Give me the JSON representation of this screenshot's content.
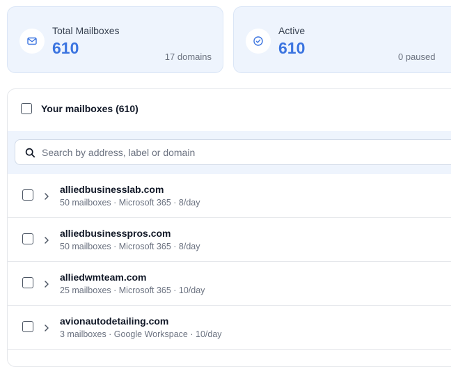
{
  "stats": [
    {
      "label": "Total Mailboxes",
      "value": "610",
      "sub": "17 domains",
      "icon": "mail-icon"
    },
    {
      "label": "Active",
      "value": "610",
      "sub": "0 paused",
      "icon": "check-circle-icon"
    }
  ],
  "mailboxes": {
    "title": "Your mailboxes (610)",
    "search_placeholder": "Search by address, label or domain",
    "search_value": "",
    "rows": [
      {
        "domain": "alliedbusinesslab.com",
        "meta": "50 mailboxes · Microsoft 365 · 8/day"
      },
      {
        "domain": "alliedbusinesspros.com",
        "meta": "50 mailboxes · Microsoft 365 · 8/day"
      },
      {
        "domain": "alliedwmteam.com",
        "meta": "25 mailboxes · Microsoft 365 · 10/day"
      },
      {
        "domain": "avionautodetailing.com",
        "meta": "3 mailboxes · Google Workspace · 10/day"
      }
    ]
  },
  "colors": {
    "accent": "#3b74e0",
    "card_bg": "#eef4fd"
  }
}
